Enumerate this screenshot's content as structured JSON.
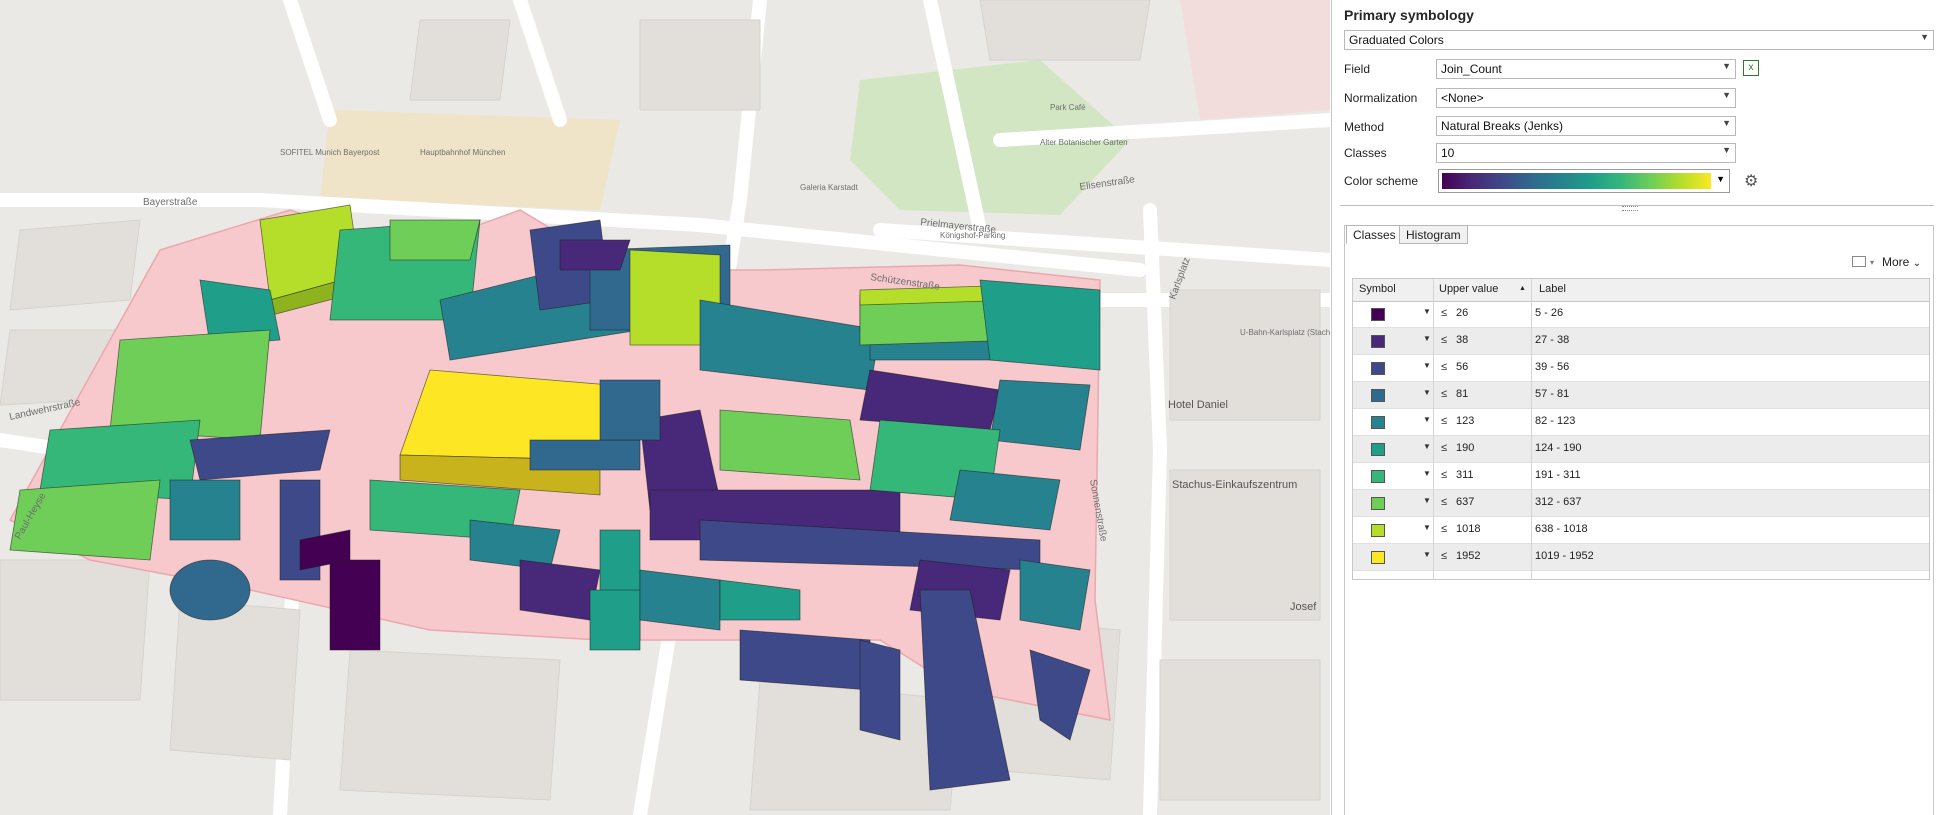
{
  "map": {
    "labels": [
      "Bayerstraße",
      "Landwehrstraße",
      "Sonnenstraße",
      "Hotel Daniel",
      "Stachus-Einkaufszentrum",
      "U-Bahn-Karlsplatz (Stachus)",
      "Schützenstraße",
      "Prielmayerstraße",
      "Elisenstraße",
      "Alter Botanischer Garten",
      "Park Café",
      "Königshof-Parking",
      "SOFITEL Munich Bayerpost",
      "Hauptbahnhof München",
      "Josef",
      "Karlsplatz",
      "Galeria Karstadt",
      "Paul-Heyse"
    ]
  },
  "panel": {
    "title": "Primary symbology",
    "renderer": "Graduated Colors",
    "field_label": "Field",
    "field_value": "Join_Count",
    "normalization_label": "Normalization",
    "normalization_value": "<None>",
    "method_label": "Method",
    "method_value": "Natural Breaks (Jenks)",
    "classes_label": "Classes",
    "classes_value": "10",
    "color_scheme_label": "Color scheme",
    "tabs": [
      "Classes",
      "Histogram"
    ],
    "more_label": "More",
    "columns": [
      "Symbol",
      "Upper value",
      "Label"
    ],
    "less_equal": "≤",
    "rows": [
      {
        "upper": "26",
        "label": "5 - 26",
        "color": "#440154"
      },
      {
        "upper": "38",
        "label": "27 - 38",
        "color": "#482878"
      },
      {
        "upper": "56",
        "label": "39 - 56",
        "color": "#3e4989"
      },
      {
        "upper": "81",
        "label": "57 - 81",
        "color": "#31688e"
      },
      {
        "upper": "123",
        "label": "82 - 123",
        "color": "#26828e"
      },
      {
        "upper": "190",
        "label": "124 - 190",
        "color": "#1f9e89"
      },
      {
        "upper": "311",
        "label": "191 - 311",
        "color": "#35b779"
      },
      {
        "upper": "637",
        "label": "312 - 637",
        "color": "#6ece58"
      },
      {
        "upper": "1018",
        "label": "638 - 1018",
        "color": "#b5de2b"
      },
      {
        "upper": "1952",
        "label": "1019 - 1952",
        "color": "#fde725"
      }
    ]
  }
}
